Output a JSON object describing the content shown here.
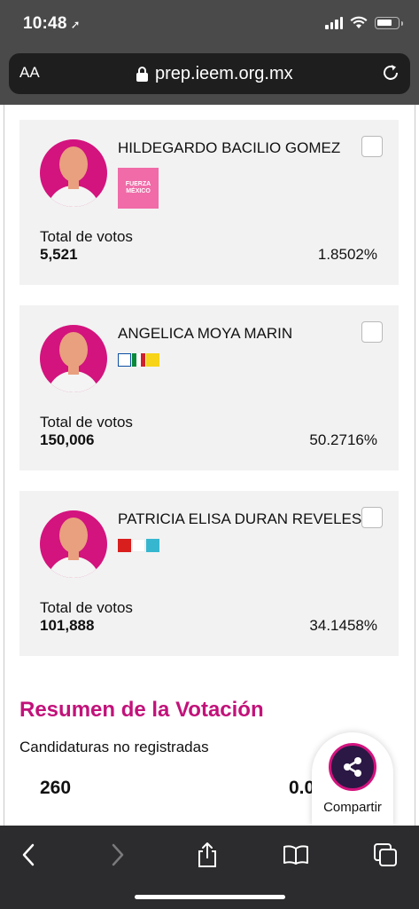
{
  "status_bar": {
    "time": "10:48"
  },
  "browser": {
    "text_size_label": "AA",
    "url": "prep.ieem.org.mx"
  },
  "candidates": [
    {
      "name": "HILDEGARDO BACILIO GOMEZ",
      "party_logo_text": [
        "FUERZA",
        "MÉXICO"
      ],
      "votes_label": "Total de votos",
      "votes": "5,521",
      "percent": "1.8502%"
    },
    {
      "name": "ANGELICA MOYA MARIN",
      "party_logos": [
        "pan-logo",
        "pri-logo",
        "prd-logo"
      ],
      "votes_label": "Total de votos",
      "votes": "150,006",
      "percent": "50.2716%"
    },
    {
      "name": "PATRICIA ELISA DURAN REVELES",
      "party_logos": [
        "pt-logo",
        "morena-logo",
        "nueva-alianza-logo"
      ],
      "votes_label": "Total de votos",
      "votes": "101,888",
      "percent": "34.1458%"
    }
  ],
  "summary": {
    "title": "Resumen de la Votación",
    "subtitle": "Candidaturas no registradas",
    "value": "260",
    "percent_partial": "0.0"
  },
  "share": {
    "label": "Compartir"
  },
  "toolbar": [
    "back-icon",
    "forward-icon",
    "share-icon",
    "bookmarks-icon",
    "tabs-icon"
  ],
  "colors": {
    "brand_magenta": "#c2127a",
    "chrome_dark": "#4a4a4a",
    "toolbar_dark": "#2c2c2e",
    "card_bg": "#f2f2f2"
  }
}
